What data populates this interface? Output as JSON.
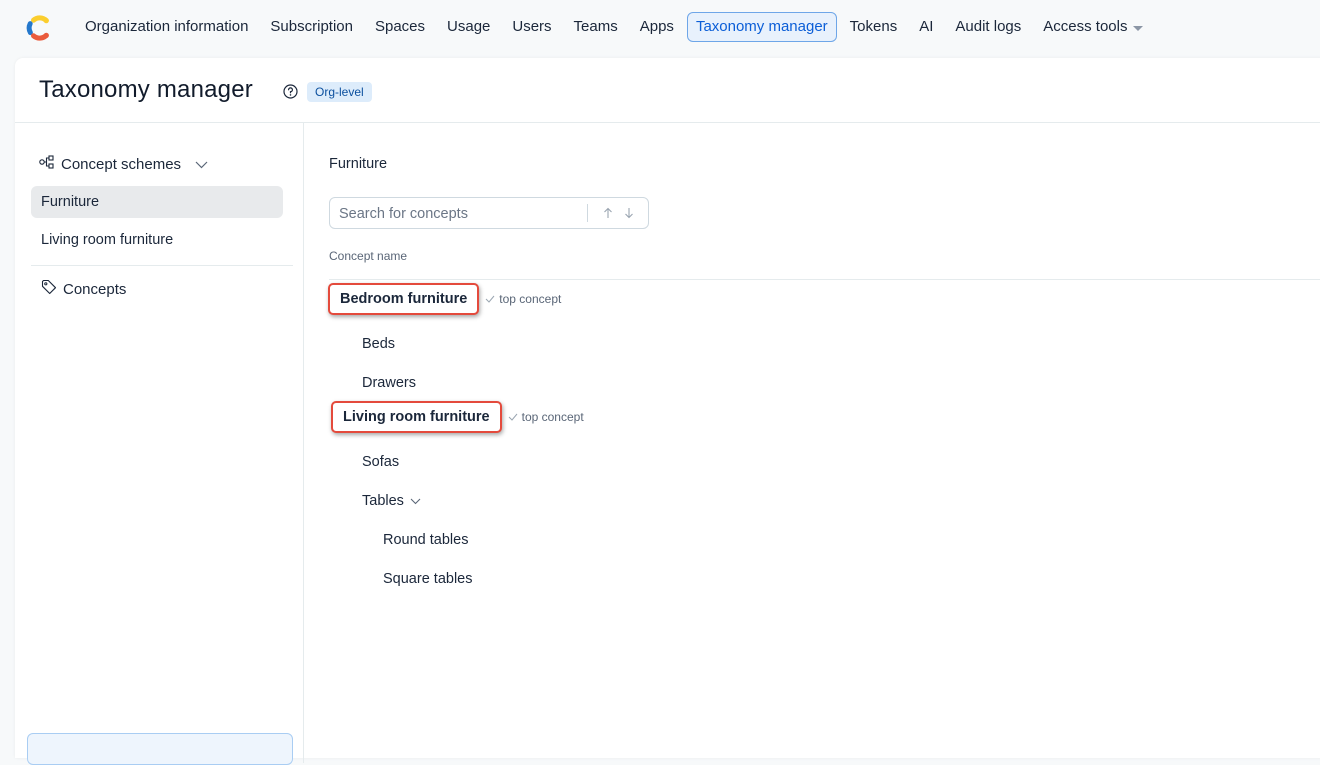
{
  "nav": {
    "items": [
      {
        "label": "Organization information"
      },
      {
        "label": "Subscription"
      },
      {
        "label": "Spaces"
      },
      {
        "label": "Usage"
      },
      {
        "label": "Users"
      },
      {
        "label": "Teams"
      },
      {
        "label": "Apps"
      },
      {
        "label": "Taxonomy manager",
        "active": true
      },
      {
        "label": "Tokens"
      },
      {
        "label": "AI"
      },
      {
        "label": "Audit logs"
      },
      {
        "label": "Access tools",
        "dropdown": true
      }
    ]
  },
  "header": {
    "title": "Taxonomy manager",
    "badge": "Org-level"
  },
  "sidebar": {
    "section_label": "Concept schemes",
    "schemes": [
      {
        "label": "Furniture",
        "selected": true
      },
      {
        "label": "Living room furniture",
        "selected": false
      }
    ],
    "concepts_label": "Concepts"
  },
  "content": {
    "scheme_title": "Furniture",
    "search_placeholder": "Search for concepts",
    "column_header": "Concept name",
    "concepts": [
      {
        "label": "Bedroom furniture",
        "tag": "top concept"
      },
      {
        "label": "Beds"
      },
      {
        "label": "Drawers"
      },
      {
        "label": "Living room furniture",
        "tag": "top concept"
      },
      {
        "label": "Sofas"
      },
      {
        "label": "Tables"
      },
      {
        "label": "Round tables"
      },
      {
        "label": "Square tables"
      }
    ]
  },
  "colors": {
    "accent": "#0b5ed7",
    "highlight_border": "#e44a3c",
    "badge_bg": "#ddecfb"
  }
}
